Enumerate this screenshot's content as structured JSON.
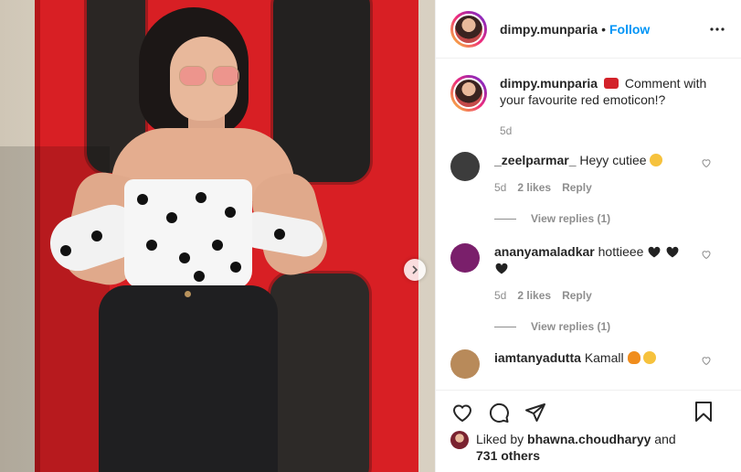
{
  "header": {
    "username": "dimpy.munparia",
    "separator": "•",
    "follow_label": "Follow"
  },
  "caption": {
    "username": "dimpy.munparia",
    "text": "Comment with your favourite red emoticon!?",
    "time": "5d"
  },
  "comments": [
    {
      "username": "_zeelparmar_",
      "text": "Heyy cutiee",
      "time": "5d",
      "likes": "2 likes",
      "reply_label": "Reply",
      "view_replies": "View replies (1)",
      "avatar_color": "#3c3c3c"
    },
    {
      "username": "ananyamaladkar",
      "text": "hottieee",
      "time": "5d",
      "likes": "2 likes",
      "reply_label": "Reply",
      "view_replies": "View replies (1)",
      "avatar_color": "#7a1f6b"
    },
    {
      "username": "iamtanyadutta",
      "text": "Kamall",
      "avatar_color": "#b88a5a"
    }
  ],
  "likes": {
    "prefix": "Liked by",
    "user": "bhawna.choudharyy",
    "and": "and",
    "others": "731 others"
  },
  "icons": [
    "more-icon",
    "heart-icon",
    "comment-icon",
    "share-icon",
    "bookmark-icon",
    "chevron-right-icon"
  ],
  "colors": {
    "accent": "#0095f6",
    "door_red": "#d81f24",
    "muted": "#8e8e8e"
  }
}
